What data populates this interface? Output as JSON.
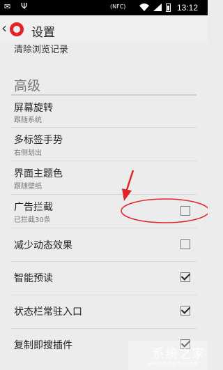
{
  "status_bar": {
    "nfc": "(NFC)",
    "time": "13:12"
  },
  "app_bar": {
    "title": "设置"
  },
  "partial_item": "清除浏览记录",
  "section": "高级",
  "items": [
    {
      "title": "屏幕旋转",
      "subtitle": "跟随系统"
    },
    {
      "title": "多标签手势",
      "subtitle": "右侧划出"
    },
    {
      "title": "界面主题色",
      "subtitle": "跟随壁纸"
    },
    {
      "title": "广告拦截",
      "subtitle": "已拦截30条",
      "checked": false
    },
    {
      "title": "减少动态效果",
      "checked": false
    },
    {
      "title": "智能预读",
      "checked": true
    },
    {
      "title": "状态栏常驻入口",
      "checked": true
    },
    {
      "title": "复制即搜插件",
      "checked": true
    }
  ],
  "annotation_color": "#e0242a",
  "watermark": {
    "text": "系统之家",
    "url": "www.xitongzhijia.net"
  }
}
